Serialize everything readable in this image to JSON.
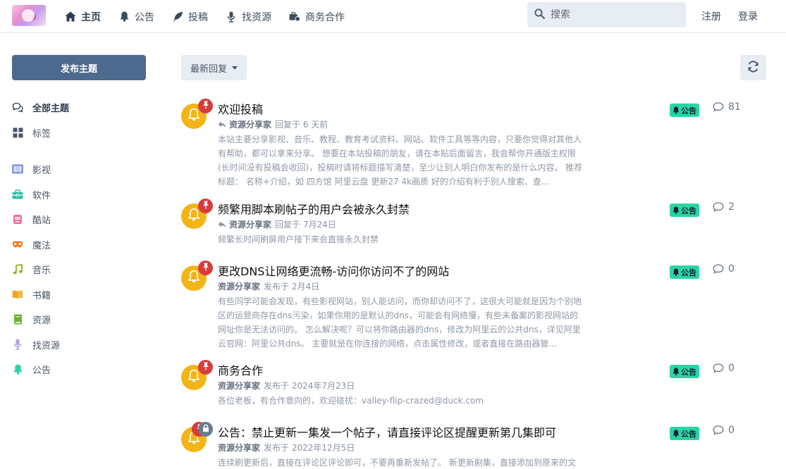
{
  "colors": {
    "primary": "#4d698e",
    "tag": "#2bd4a4",
    "avatar": "#f2b515",
    "pin": "#d83b3b",
    "lock": "#6a7b91"
  },
  "nav": {
    "items": [
      {
        "label": "主页",
        "icon": "home-icon"
      },
      {
        "label": "公告",
        "icon": "bell-icon"
      },
      {
        "label": "投稿",
        "icon": "feather-icon"
      },
      {
        "label": "找资源",
        "icon": "microphone-icon"
      },
      {
        "label": "商务合作",
        "icon": "handshake-icon"
      }
    ]
  },
  "search": {
    "placeholder": "搜索"
  },
  "auth": {
    "signup": "注册",
    "login": "登录"
  },
  "sidebar": {
    "post_button": "发布主题",
    "items": [
      {
        "label": "全部主题",
        "icon": "comments-icon"
      },
      {
        "label": "标签",
        "icon": "grid-icon"
      },
      {
        "label": "影视",
        "icon": "film-icon"
      },
      {
        "label": "软件",
        "icon": "toolbox-icon"
      },
      {
        "label": "酷站",
        "icon": "robot-icon"
      },
      {
        "label": "魔法",
        "icon": "mask-icon"
      },
      {
        "label": "音乐",
        "icon": "music-icon"
      },
      {
        "label": "书籍",
        "icon": "book-icon"
      },
      {
        "label": "资源",
        "icon": "book-green-icon"
      },
      {
        "label": "找资源",
        "icon": "microphone-icon"
      },
      {
        "label": "公告",
        "icon": "bell-icon"
      }
    ]
  },
  "toolbar": {
    "sort_label": "最新回复"
  },
  "discussions": [
    {
      "title": "欢迎投稿",
      "author": "资源分享家",
      "action": "回复于 6 天前",
      "excerpt": "本站主要分享影视、音乐、教程、教育考试资料、网站、软件工具等等内容，只要你觉得对其他人有帮助，都可以拿来分享。 想要在本站投稿的朋友，请在本贴后面留言，我会帮你开通版主权限(长时间没有投稿会收回)，投稿时请将标题描写清楚，至少让别人明白你发布的是什么内容。 推荐标题： 名称+介绍，如 四方馆 阿里云盘 更新27 4k画质 好的介绍有利于别人搜索、查...",
      "tag": "公告",
      "count": "81"
    },
    {
      "title": "频繁用脚本刷帖子的用户会被永久封禁",
      "author": "资源分享家",
      "action": "回复于 7月24日",
      "excerpt": "频繁长时间刷屏用户接下来会直接永久封禁",
      "tag": "公告",
      "count": "2"
    },
    {
      "title": "更改DNS让网络更流畅-访问你访问不了的网站",
      "author": "资源分享家",
      "action": "发布于 2月4日",
      "excerpt": "有些同学可能会发现，有些影视网站，别人能访问，而你却访问不了，这很大可能就是因为个别地区的运营商存在dns污染，如果你用的是默认的dns，可能会有网络慢，有些未备案的影视网站的网址你是无法访问的。 怎么解决呢？可以将你路由器的dns，修改为阿里云的公共dns，详见阿里云官网：阿里公共dns。 主要就是在你连接的网络，点击属性修改，或者直接在路由器管...",
      "tag": "公告",
      "count": "0"
    },
    {
      "title": "商务合作",
      "author": "资源分享家",
      "action": "发布于 2024年7月23日",
      "excerpt": "各位老板，有合作意向的，欢迎碰扰：valley-flip-crazed@duck.com",
      "tag": "公告",
      "count": "0"
    },
    {
      "title": "公告：禁止更新一集发一个帖子，请直接评论区提醒更新第几集即可",
      "author": "资源分享家",
      "action": "发布于 2022年12月5日",
      "excerpt": "连续刷更新后，直接在评论区评论即可，不要再重新发帖了。 新更新剧集，直接添加到原来的文",
      "tag": "公告",
      "count": "0"
    }
  ]
}
